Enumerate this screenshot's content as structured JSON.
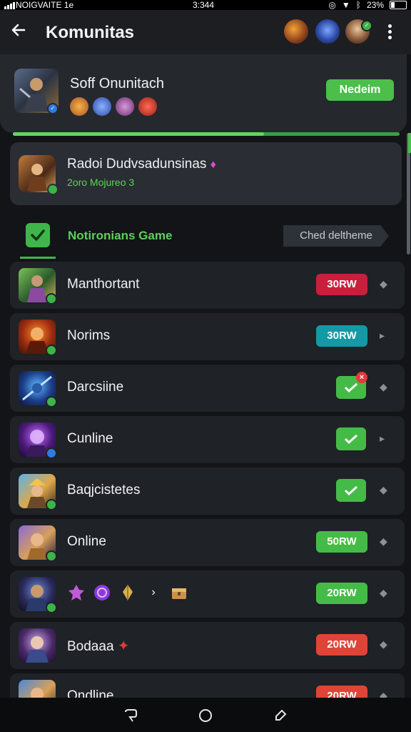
{
  "status": {
    "carrier": "NOIGVAITE 1e",
    "time": "3:344",
    "battery": "23%"
  },
  "header": {
    "title": "Komunitas"
  },
  "top_card": {
    "name": "Soff Onunitach",
    "button": "Nedeim"
  },
  "progress": {
    "value": 0.65
  },
  "second_card": {
    "name": "Radoi Dudvsadunsinas",
    "sub": "2oro Mojureo 3"
  },
  "tab": {
    "label": "Notironians Game",
    "filter": "Ched deltheme"
  },
  "rows": [
    {
      "label": "Manthortant",
      "badge": "30RW",
      "badge_color": "#c8203c"
    },
    {
      "label": "Norims",
      "badge": "30RW",
      "badge_color": "#139aa6"
    },
    {
      "label": "Darcsiine"
    },
    {
      "label": "Cunline"
    },
    {
      "label": "Baqjcistetes"
    },
    {
      "label": "Online",
      "badge": "50RW",
      "badge_color": "#45bb47"
    },
    {
      "badge": "20RW",
      "badge_color": "#45bb47"
    },
    {
      "label": "Bodaaa",
      "badge": "20RW",
      "badge_color": "#e04437"
    },
    {
      "label": "Ondline",
      "badge": "20RW",
      "badge_color": "#e04437"
    }
  ],
  "colors": {
    "accent": "#4bbf4a",
    "background": "#131417",
    "card": "#25282d"
  }
}
